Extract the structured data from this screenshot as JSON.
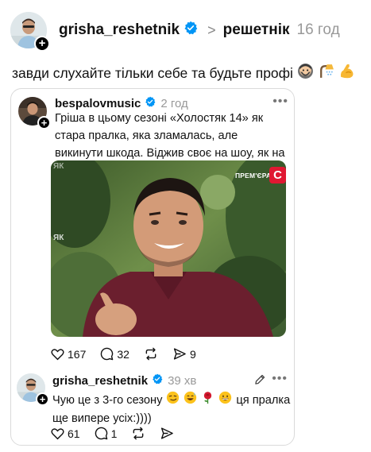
{
  "post": {
    "username": "grisha_reshetnik",
    "community": "решетнік",
    "time": "16 год",
    "caption": "завди слухайте тільки себе та будьте профі"
  },
  "quote": {
    "username": "bespalovmusic",
    "time": "2 год",
    "text": "Гріша в цьому сезоні «Холостяк 14» як стара пралка, яка зламалась, але викинути шкода. Віджив своє на шоу, як на мене.",
    "video": {
      "watermark_top": "ЯК",
      "watermark_side": "ЯК",
      "badge": "ПРЕМ'ЄРА",
      "logo": "C"
    },
    "likes": "167",
    "comments": "32",
    "shares": "9"
  },
  "reply": {
    "username": "grisha_reshetnik",
    "time": "39 хв",
    "text_line1": "Чую це з 3-го сезону",
    "text_line1_tail": "ця пралка",
    "text_line2": "ще випере усіх:))))",
    "likes": "61",
    "comments": "1"
  },
  "icons": {
    "verified": "verified-badge-icon",
    "like": "heart-icon",
    "comment": "comment-icon",
    "repost": "repost-icon",
    "share": "send-icon",
    "more": "more-icon",
    "edit": "pencil-icon",
    "follow": "plus-icon"
  },
  "colors": {
    "verified": "#0095f6",
    "muted": "#999999",
    "logo_red": "#e01832"
  }
}
